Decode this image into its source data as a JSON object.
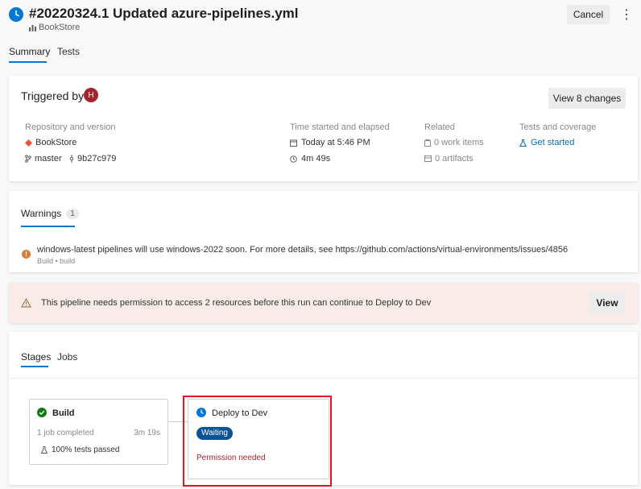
{
  "header": {
    "title": "#20220324.1 Updated azure-pipelines.yml",
    "project": "BookStore",
    "cancel_label": "Cancel",
    "more_label": "⋮"
  },
  "tabs": [
    {
      "label": "Summary",
      "selected": true
    },
    {
      "label": "Tests",
      "selected": false
    }
  ],
  "triggered": {
    "title": "Triggered by",
    "avatar_initial": "H",
    "view_changes_label": "View 8 changes",
    "repo_label": "Repository and version",
    "repo_name": "BookStore",
    "branch": "master",
    "commit": "9b27c979",
    "time_label": "Time started and elapsed",
    "started": "Today at 5:46 PM",
    "elapsed": "4m 49s",
    "related_label": "Related",
    "work_items": "0 work items",
    "artifacts": "0 artifacts",
    "tests_label": "Tests and coverage",
    "tests_link": "Get started"
  },
  "warnings": {
    "tab_label": "Warnings",
    "count": "1",
    "message": "windows-latest pipelines will use windows-2022 soon. For more details, see https://github.com/actions/virtual-environments/issues/4856",
    "source": "Build • build"
  },
  "permission": {
    "message": "This pipeline needs permission to access 2 resources before this run can continue to Deploy to Dev",
    "view_label": "View"
  },
  "stages": {
    "tabs": [
      {
        "label": "Stages",
        "selected": true
      },
      {
        "label": "Jobs",
        "selected": false
      }
    ],
    "build": {
      "name": "Build",
      "jobs": "1 job completed",
      "duration": "3m 19s",
      "tests": "100% tests passed"
    },
    "deploy": {
      "name": "Deploy to Dev",
      "status": "Waiting",
      "note": "Permission needed"
    }
  },
  "colors": {
    "accent": "#0078d4",
    "success": "#107c10",
    "warning_orange": "#d67f3c",
    "error_red": "#a4262c",
    "highlight_red": "#e81123",
    "avatar": "#a4262c"
  }
}
